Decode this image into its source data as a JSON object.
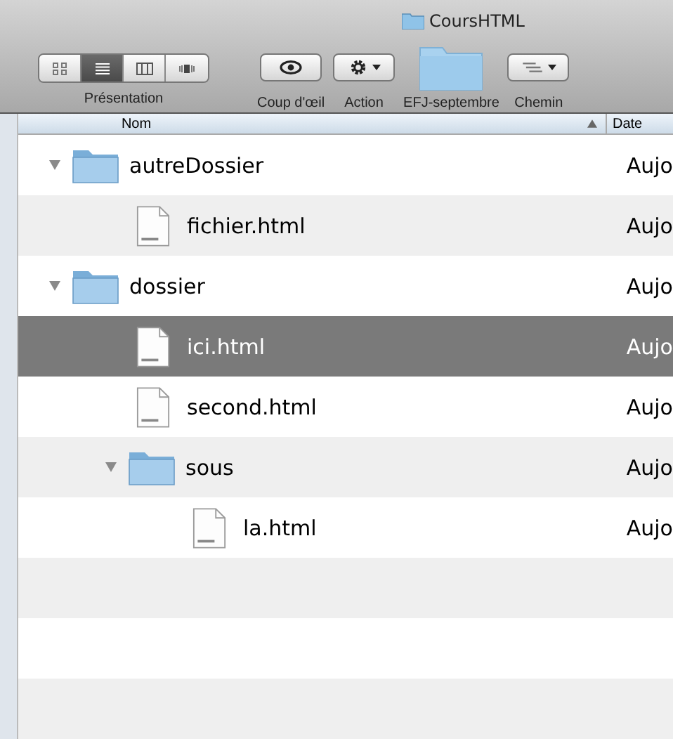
{
  "window": {
    "title": "CoursHTML"
  },
  "toolbar": {
    "view_modes": [
      {
        "kind": "icons",
        "selected": false
      },
      {
        "kind": "list",
        "selected": true
      },
      {
        "kind": "columns",
        "selected": false
      },
      {
        "kind": "coverflow",
        "selected": false
      }
    ],
    "view_label": "Présentation",
    "items": [
      {
        "kind": "quicklook",
        "label": "Coup d'œil"
      },
      {
        "kind": "action",
        "label": "Action"
      },
      {
        "kind": "folder",
        "label": "EFJ-septembre"
      },
      {
        "kind": "path",
        "label": "Chemin"
      }
    ]
  },
  "columns": [
    {
      "label": "Nom",
      "sorted": true
    },
    {
      "label": "Date",
      "sorted": false
    }
  ],
  "rows": [
    {
      "kind": "folder",
      "name": "autreDossier",
      "date": "Aujo",
      "expanded": true,
      "selected": false,
      "children": [
        {
          "kind": "file",
          "name": "fichier.html",
          "date": "Aujo",
          "selected": false
        }
      ]
    },
    {
      "kind": "folder",
      "name": "dossier",
      "date": "Aujo",
      "expanded": true,
      "selected": false,
      "children": [
        {
          "kind": "file",
          "name": "ici.html",
          "date": "Aujo",
          "selected": true
        },
        {
          "kind": "file",
          "name": "second.html",
          "date": "Aujo",
          "selected": false
        },
        {
          "kind": "folder",
          "name": "sous",
          "date": "Aujo",
          "expanded": true,
          "selected": false,
          "children": [
            {
              "kind": "file",
              "name": "la.html",
              "date": "Aujo",
              "selected": false
            }
          ]
        }
      ]
    }
  ]
}
